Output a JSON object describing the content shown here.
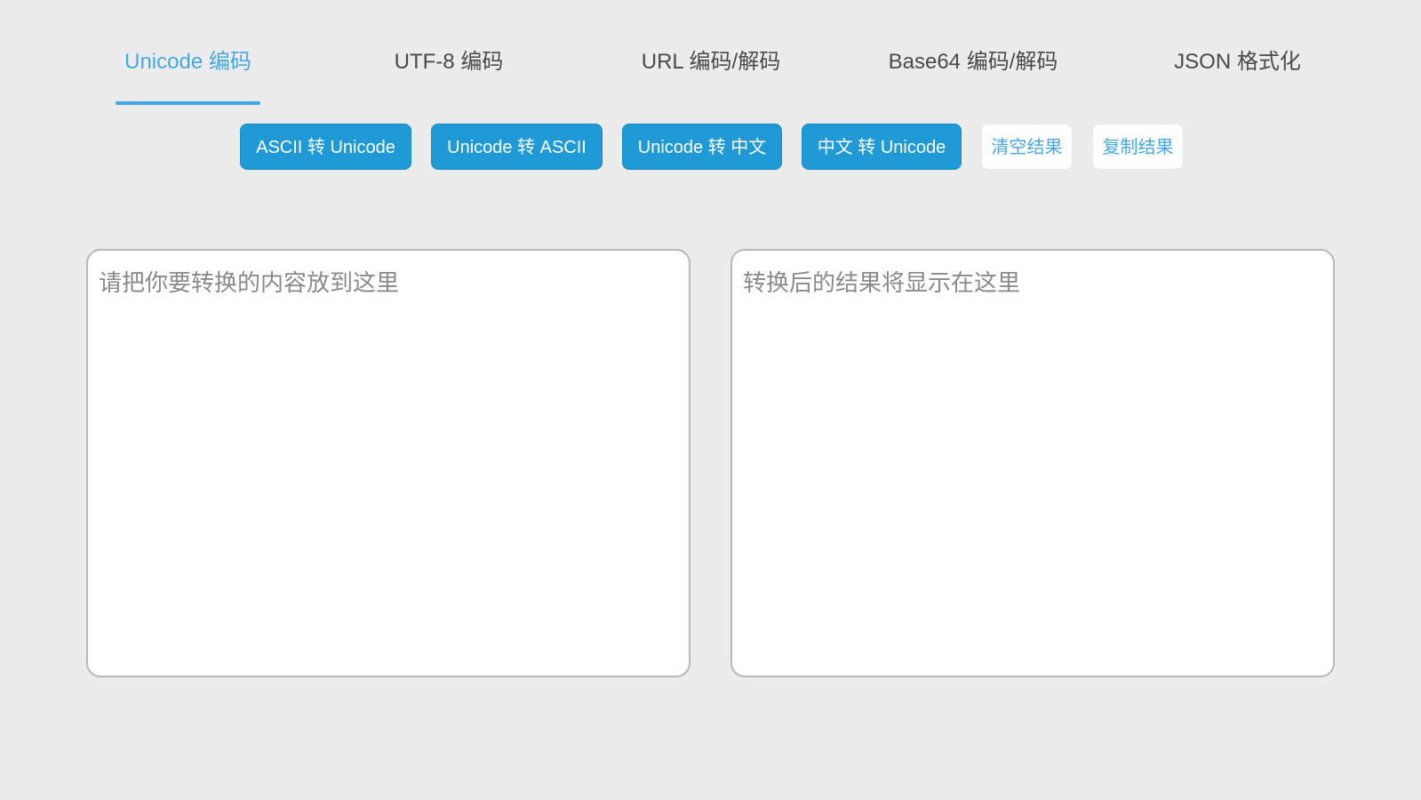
{
  "tabs": [
    {
      "label": "Unicode 编码",
      "active": true
    },
    {
      "label": "UTF-8 编码",
      "active": false
    },
    {
      "label": "URL 编码/解码",
      "active": false
    },
    {
      "label": "Base64 编码/解码",
      "active": false
    },
    {
      "label": "JSON 格式化",
      "active": false
    }
  ],
  "actions": {
    "ascii_to_unicode": "ASCII 转 Unicode",
    "unicode_to_ascii": "Unicode 转 ASCII",
    "unicode_to_chinese": "Unicode 转 中文",
    "chinese_to_unicode": "中文 转 Unicode",
    "clear_result": "清空结果",
    "copy_result": "复制结果"
  },
  "input": {
    "placeholder": "请把你要转换的内容放到这里",
    "value": ""
  },
  "output": {
    "placeholder": "转换后的结果将显示在这里",
    "value": ""
  },
  "colors": {
    "accent": "#46a8e2",
    "primary_button": "#1f9ad6",
    "background": "#ececec"
  }
}
